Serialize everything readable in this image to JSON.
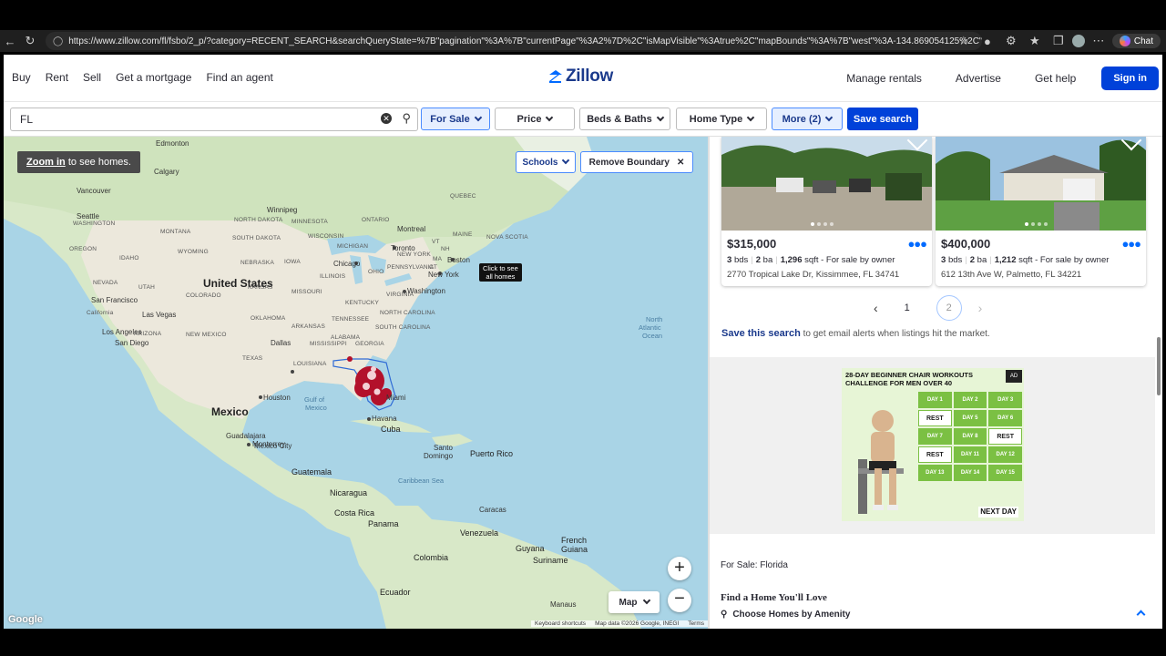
{
  "browser": {
    "url": "https://www.zillow.com/fl/fsbo/2_p/?category=RECENT_SEARCH&searchQueryState=%7B\"pagination\"%3A%7B\"currentPage\"%3A2%7D%2C\"isMapVisible\"%3Atrue%2C\"mapBounds\"%3A%7B\"west\"%3A-134.869054125%2C\"east\"%3A-32.74...",
    "chat_label": "Chat"
  },
  "nav": {
    "left": [
      "Buy",
      "Rent",
      "Sell",
      "Get a mortgage",
      "Find an agent"
    ],
    "logo": "Zillow",
    "right": [
      "Manage rentals",
      "Advertise",
      "Get help"
    ],
    "sign_in": "Sign in"
  },
  "filters": {
    "search_value": "FL",
    "for_sale": "For Sale",
    "price": "Price",
    "beds_baths": "Beds & Baths",
    "home_type": "Home Type",
    "more": "More (2)",
    "save_search": "Save search"
  },
  "map": {
    "zoom_hint_link": "Zoom in",
    "zoom_hint_rest": " to see homes.",
    "schools": "Schools",
    "remove_boundary": "Remove Boundary",
    "click_tip_line1": "Click to see",
    "click_tip_line2": "all homes",
    "map_type": "Map",
    "google": "Google",
    "attrib_shortcuts": "Keyboard shortcuts",
    "attrib_data": "Map data ©2026 Google, INEGI",
    "attrib_terms": "Terms",
    "labels": {
      "edmonton": "Edmonton",
      "calgary": "Calgary",
      "vancouver": "Vancouver",
      "winnipeg": "Winnipeg",
      "seattle": "Seattle",
      "montreal": "Montreal",
      "toronto": "Toronto",
      "chicago": "Chicago",
      "boston": "Boston",
      "newyork": "New York",
      "washington": "Washington",
      "sanfrancisco": "San Francisco",
      "lasvegas": "Las Vegas",
      "losangeles": "Los Angeles",
      "sandiego": "San Diego",
      "dallas": "Dallas",
      "houston": "Houston",
      "monterrey": "Monterrey",
      "miami": "Miami",
      "havana": "Havana",
      "cuba": "Cuba",
      "mexico": "Mexico",
      "mexicocity": "Mexico City",
      "guadalajara": "Guadalajara",
      "guatemala": "Guatemala",
      "nicaragua": "Nicaragua",
      "costarica": "Costa Rica",
      "panama": "Panama",
      "santodomingo1": "Santo",
      "santodomingo2": "Domingo",
      "puertorico": "Puerto Rico",
      "caribbean": "Caribbean Sea",
      "caracas": "Caracas",
      "venezuela": "Venezuela",
      "colombia": "Colombia",
      "guyana": "Guyana",
      "suriname": "Suriname",
      "frenchguiana1": "French",
      "frenchguiana2": "Guiana",
      "ecuador": "Ecuador",
      "manaus": "Manaus",
      "unitedstates": "United States",
      "gulf1": "Gulf of",
      "gulf2": "Mexico",
      "atlantic1": "North",
      "atlantic2": "Atlantic",
      "atlantic3": "Ocean",
      "s_ontario": "ONTARIO",
      "s_quebec": "QUEBEC",
      "s_maine": "MAINE",
      "s_novascotia": "NOVA SCOTIA",
      "s_washington": "WASHINGTON",
      "s_oregon": "OREGON",
      "s_idaho": "IDAHO",
      "s_montana": "MONTANA",
      "s_wyoming": "WYOMING",
      "s_nevada": "NEVADA",
      "s_utah": "UTAH",
      "s_colorado": "COLORADO",
      "s_california": "California",
      "s_arizona": "ARIZONA",
      "s_newmexico": "NEW MEXICO",
      "s_northdakota": "NORTH DAKOTA",
      "s_southdakota": "SOUTH DAKOTA",
      "s_nebraska": "NEBRASKA",
      "s_kansas": "KANSAS",
      "s_oklahoma": "OKLAHOMA",
      "s_texas": "TEXAS",
      "s_minnesota": "MINNESOTA",
      "s_iowa": "IOWA",
      "s_missouri": "MISSOURI",
      "s_wisconsin": "WISCONSIN",
      "s_michigan": "MICHIGAN",
      "s_illinois": "ILLINOIS",
      "s_ohio": "OHIO",
      "s_kentucky": "KENTUCKY",
      "s_tennessee": "TENNESSEE",
      "s_arkansas": "ARKANSAS",
      "s_mississippi": "MISSISSIPPI",
      "s_louisiana": "LOUISIANA",
      "s_alabama": "ALABAMA",
      "s_georgia": "GEORGIA",
      "s_southcarolina": "SOUTH CAROLINA",
      "s_northcarolina": "NORTH CAROLINA",
      "s_virginia": "VIRGINIA",
      "s_pennsylvania": "PENNSYLVANIA",
      "s_newyork": "NEW YORK",
      "s_vt": "VT",
      "s_nh": "NH",
      "s_ma": "MA",
      "s_ct": "CT"
    }
  },
  "listings": [
    {
      "price": "$315,000",
      "beds": "3",
      "beds_unit": "bds",
      "baths": "2",
      "baths_unit": "ba",
      "sqft": "1,296",
      "sqft_unit": "sqft",
      "type": "- For sale by owner",
      "address": "2770 Tropical Lake Dr, Kissimmee, FL 34741"
    },
    {
      "price": "$400,000",
      "beds": "3",
      "beds_unit": "bds",
      "baths": "2",
      "baths_unit": "ba",
      "sqft": "1,212",
      "sqft_unit": "sqft",
      "type": "- For sale by owner",
      "address": "612 13th Ave W, Palmetto, FL 34221"
    }
  ],
  "pagination": {
    "page1": "1",
    "page2": "2"
  },
  "save_search_line": {
    "link": "Save this search",
    "rest": " to get email alerts when listings hit the market."
  },
  "ad": {
    "title": "28-DAY BEGINNER CHAIR WORKOUTS CHALLENGE FOR MEN OVER 40",
    "badge": "AD",
    "days": [
      "DAY 1",
      "DAY 2",
      "DAY 3",
      "REST",
      "DAY 5",
      "DAY 6",
      "DAY 7",
      "DAY 8",
      "REST",
      "REST",
      "DAY 11",
      "DAY 12",
      "DAY 13",
      "DAY 14",
      "DAY 15"
    ],
    "next_day": "NEXT DAY"
  },
  "footer": {
    "for_sale": "For Sale: Florida",
    "find_home": "Find a Home You'll Love",
    "amenity": "Choose Homes by Amenity"
  },
  "colors": {
    "brand_blue": "#0041d9",
    "zillow_blue": "#006aff",
    "map_water": "#a9d4e6",
    "cluster": "#b3112b"
  }
}
